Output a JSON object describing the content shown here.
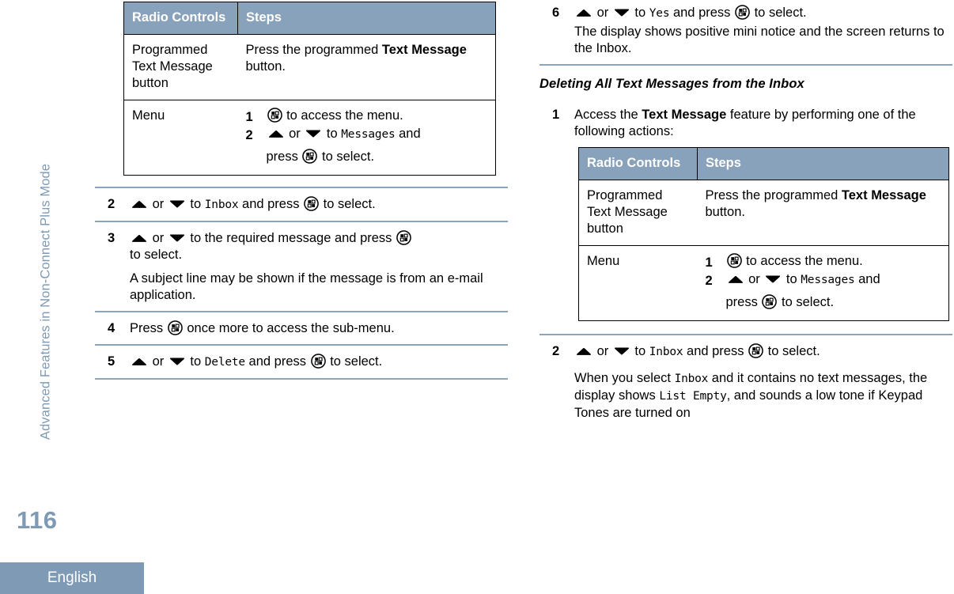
{
  "colors": {
    "accent": "#7e9ab5",
    "table_header_bg": "#89a2bb",
    "rule": "#8ba4bd",
    "text": "#000000"
  },
  "rail": {
    "chapter_title": "Advanced Features in Non-Connect Plus Mode",
    "page_number": "116",
    "language": "English"
  },
  "table": {
    "headers": [
      "Radio Controls",
      "Steps"
    ],
    "header_display": [
      "Radio Con-\ntrols",
      "Steps"
    ],
    "rows": [
      {
        "control": "Programmed Text Message button",
        "steps_text": "Press the programmed Text Message button.",
        "steps_pre": "Press the programmed ",
        "steps_bold": "Text Message",
        "steps_post": " button."
      },
      {
        "control": "Menu",
        "substeps": [
          {
            "num": "1",
            "pre": "",
            "icon": "menu-button-icon",
            "post": " to access the menu."
          },
          {
            "num": "2",
            "line1_pre": "",
            "line1_mid_or": " or ",
            "line1_post": " to ",
            "display": "Messages",
            "line1_tail": " and",
            "line2_pre": "press ",
            "line2_post": " to select."
          }
        ]
      }
    ]
  },
  "left_column": {
    "steps": [
      {
        "num": "2",
        "parts": {
          "or": " or ",
          "to": " to ",
          "display": "Inbox",
          "and_press": " and press ",
          "tail": " to select."
        }
      },
      {
        "num": "3",
        "parts": {
          "or": " or ",
          "to": " to the required message and press ",
          "tail": "to select."
        },
        "note": "A subject line may be shown if the message is from an e-mail application."
      },
      {
        "num": "4",
        "parts": {
          "lead": "Press ",
          "tail": " once more to access the sub-menu."
        }
      },
      {
        "num": "5",
        "parts": {
          "or": " or ",
          "to": " to ",
          "display": "Delete",
          "and_press": " and press ",
          "tail": " to select."
        }
      }
    ]
  },
  "right_column": {
    "step6": {
      "num": "6",
      "parts": {
        "or": " or ",
        "to": " to ",
        "display": "Yes",
        "and_press": " and press ",
        "tail": " to select."
      },
      "note": "The display shows positive mini notice and the screen returns to the Inbox."
    },
    "heading": "Deleting All Text Messages from the Inbox",
    "step1": {
      "num": "1",
      "pre": "Access the ",
      "bold": "Text Message",
      "post": " feature by performing one of the following actions:"
    },
    "step2": {
      "num": "2",
      "parts": {
        "or": " or ",
        "to": " to ",
        "display": "Inbox",
        "and_press": " and press ",
        "tail": " to select."
      },
      "note_pre": "When you select ",
      "note_display1": "Inbox",
      "note_mid": " and it contains no text messages, the display shows ",
      "note_display2": "List Empty",
      "note_post": ", and sounds a low tone if Keypad Tones are turned on"
    }
  },
  "icons": {
    "menu": "menu-button-icon",
    "up": "arrow-up-icon",
    "down": "arrow-down-icon"
  }
}
